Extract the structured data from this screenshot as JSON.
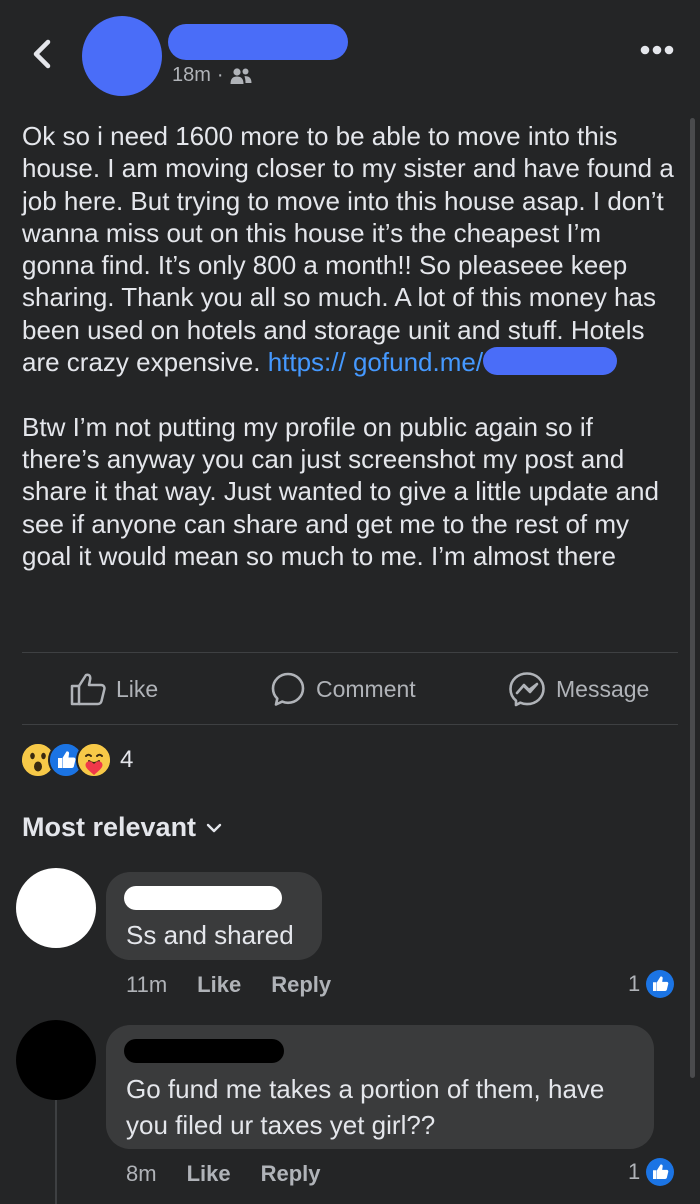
{
  "colors": {
    "accent": "#4a6df8",
    "link": "#4599ff",
    "background": "#242526",
    "bubble": "#3a3b3c"
  },
  "header": {
    "time": "18m",
    "separator": "·",
    "audience_icon": "friends-icon",
    "back_icon": "chevron-left-icon",
    "more_icon": "more-horizontal-icon"
  },
  "post": {
    "paragraph1": "Ok so i need 1600 more to be able to move into this house. I am moving closer to my sister and have found a job here. But trying to move into this house asap. I don’t wanna miss out on this house it’s the cheapest I’m gonna find. It’s only 800 a month!! So pleaseee keep sharing. Thank you all so much. A lot of this money has been used on hotels and storage unit and stuff. Hotels are crazy expensive.",
    "link_prefix": "https://",
    "link_domain": "gofund.me/",
    "paragraph2": "Btw I’m not putting my profile on public again so if there’s anyway you can just screenshot my post and share it that way. Just wanted to give a little update and see if anyone can share and get me to the rest of my goal it would mean so much to me. I’m almost there"
  },
  "actions": {
    "like": "Like",
    "comment": "Comment",
    "message": "Message"
  },
  "reactions": {
    "count": "4",
    "types": [
      "wow",
      "like",
      "care"
    ]
  },
  "sort": {
    "label": "Most relevant"
  },
  "comments": [
    {
      "text": "Ss and shared",
      "time": "11m",
      "like": "Like",
      "reply": "Reply",
      "likes": "1"
    },
    {
      "text": "Go fund me takes a portion of them, have you filed ur taxes yet girl??",
      "time": "8m",
      "like": "Like",
      "reply": "Reply",
      "likes": "1"
    }
  ]
}
